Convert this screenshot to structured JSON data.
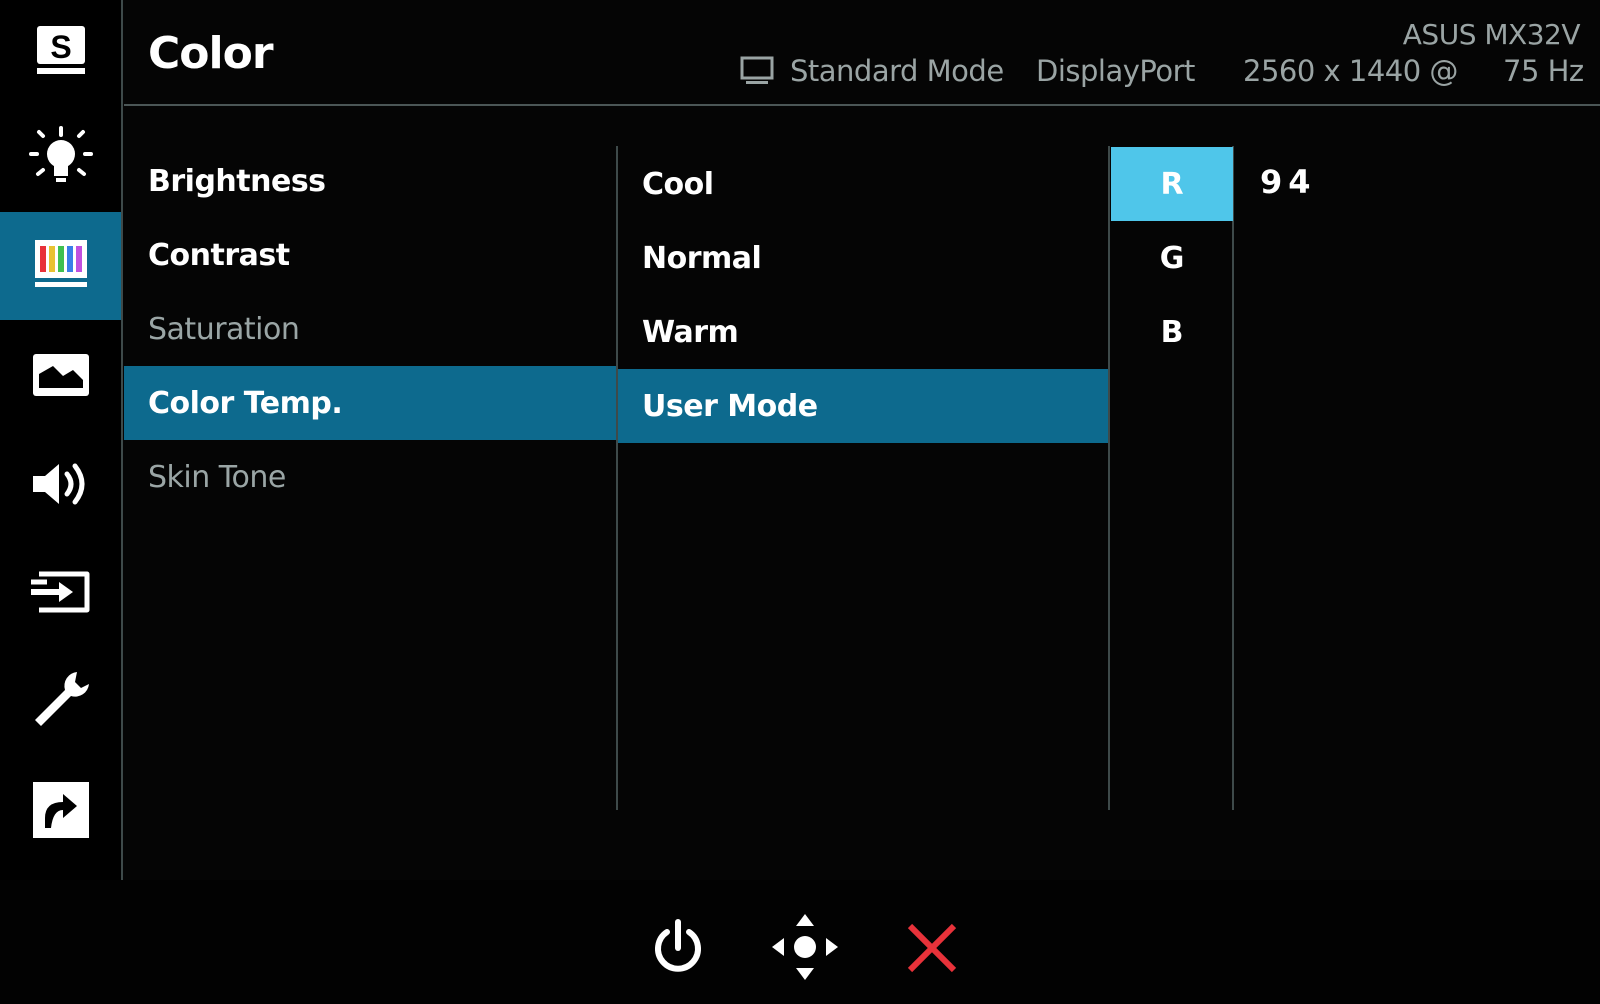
{
  "header": {
    "title": "Color",
    "model": "ASUS MX32V",
    "mode": "Standard Mode",
    "input": "DisplayPort",
    "resolution": "2560 x 1440 @",
    "refresh": "75 Hz"
  },
  "sidebar": {
    "items": [
      {
        "name": "splendid",
        "icon": "splendid-s-icon"
      },
      {
        "name": "blue-light",
        "icon": "light-bulb-icon"
      },
      {
        "name": "color",
        "icon": "color-bars-icon",
        "active": true
      },
      {
        "name": "image",
        "icon": "image-icon"
      },
      {
        "name": "sound",
        "icon": "speaker-icon"
      },
      {
        "name": "input-select",
        "icon": "input-icon"
      },
      {
        "name": "system-setup",
        "icon": "wrench-icon"
      },
      {
        "name": "shortcut",
        "icon": "shortcut-arrow-icon"
      }
    ]
  },
  "menu": {
    "items": [
      "Brightness",
      "Contrast",
      "Saturation",
      "Color Temp.",
      "Skin Tone"
    ],
    "selected": "Color Temp."
  },
  "submenu": {
    "items": [
      "Cool",
      "Normal",
      "Warm",
      "User Mode"
    ],
    "selected": "User Mode"
  },
  "rgb": {
    "items": [
      "R",
      "G",
      "B"
    ],
    "selected": "R",
    "value": "94"
  },
  "controls": {
    "buttons": [
      "power-icon",
      "navigate-joystick-icon",
      "close-icon"
    ]
  },
  "colors": {
    "highlight": "#0d6a8e",
    "active_channel": "#4fc6ea",
    "close": "#e8323a"
  }
}
